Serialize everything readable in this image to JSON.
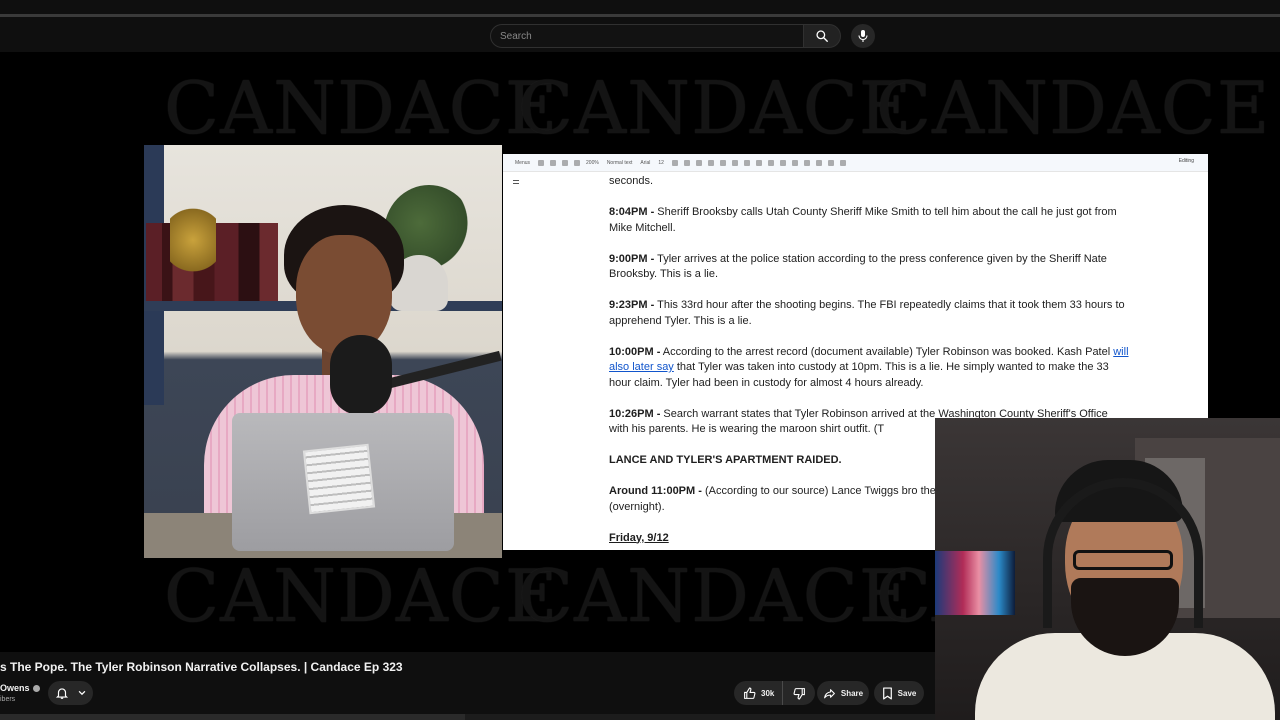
{
  "search": {
    "placeholder": "Search"
  },
  "watermark": {
    "text": "CANDACE"
  },
  "document": {
    "toolbar": {
      "menus_label": "Menus",
      "zoom": "200%",
      "style": "Normal text",
      "font": "Arial",
      "font_size": "12",
      "mode": "Editing"
    },
    "entries": [
      {
        "text": "seconds."
      },
      {
        "time": "8:04PM -",
        "text": " Sheriff Brooksby calls Utah County Sheriff Mike Smith to tell him about the call he just got from Mike Mitchell."
      },
      {
        "time": "9:00PM -",
        "text": " Tyler arrives at the police station according to the press conference given by the Sheriff Nate Brooksby. This is a lie."
      },
      {
        "time": "9:23PM -",
        "text": " This 33rd hour after the shooting begins. The FBI repeatedly claims that it took them 33 hours to apprehend Tyler. This is a lie."
      },
      {
        "time": "10:00PM -",
        "text_before": " According to the arrest record (document available) Tyler Robinson was booked. Kash Patel ",
        "link": "will also later say",
        "text_after": " that Tyler was taken into custody at 10pm. This is a lie. He simply wanted to make the 33 hour claim. Tyler had been in custody for almost 4 hours already."
      },
      {
        "time": "10:26PM -",
        "text": " Search warrant states that Tyler Robinson arrived at the Washington County Sheriff's Office with his parents. He is wearing the maroon shirt outfit. (T"
      },
      {
        "heading": "LANCE AND TYLER'S APARTMENT RAIDED."
      },
      {
        "time": "Around 11:00PM -",
        "text": " (According to our source) Lance Twiggs bro thereafter, their shared apartment is raided (overnight)."
      },
      {
        "date": "Friday, 9/12"
      }
    ]
  },
  "video": {
    "title": "s The Pope. The Tyler Robinson Narrative Collapses. | Candace Ep 323",
    "channel": "Owens",
    "subscribers": "ibers",
    "likes": "30k",
    "share_label": "Share",
    "save_label": "Save"
  }
}
